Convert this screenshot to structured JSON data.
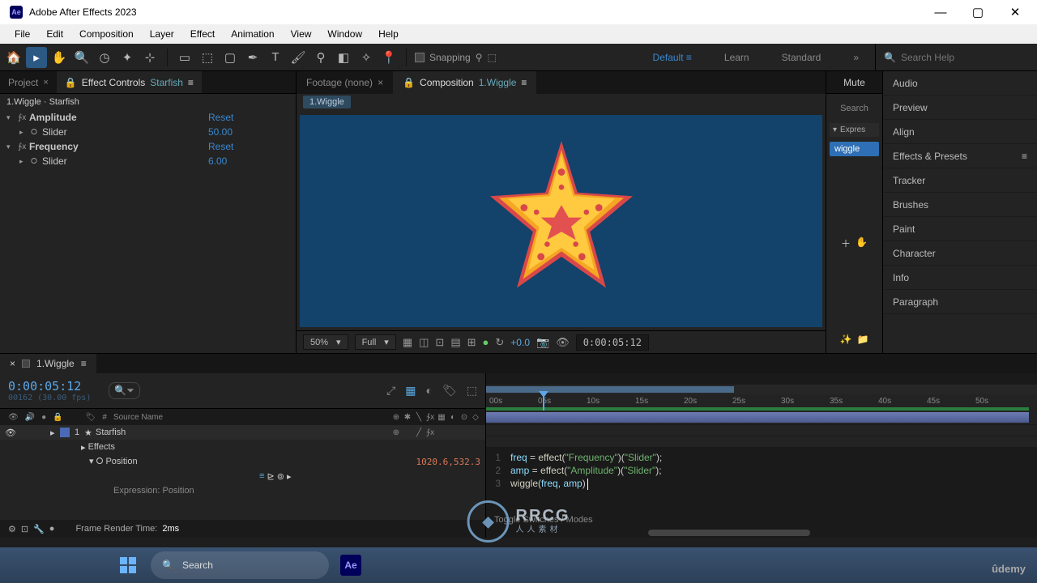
{
  "title": "Adobe After Effects 2023",
  "app_abbr": "Ae",
  "menubar": [
    "File",
    "Edit",
    "Composition",
    "Layer",
    "Effect",
    "Animation",
    "View",
    "Window",
    "Help"
  ],
  "toolbar": {
    "snapping_label": "Snapping",
    "workspace_default": "Default",
    "workspace_learn": "Learn",
    "workspace_standard": "Standard",
    "search_placeholder": "Search Help"
  },
  "left_panel": {
    "tab_project": "Project",
    "tab_effect_controls": "Effect Controls",
    "tab_layer": "Starfish",
    "breadcrumb": "1.Wiggle · Starfish",
    "effects": [
      {
        "name": "Amplitude",
        "reset": "Reset",
        "slider_label": "Slider",
        "slider_value": "50.00"
      },
      {
        "name": "Frequency",
        "reset": "Reset",
        "slider_label": "Slider",
        "slider_value": "6.00"
      }
    ]
  },
  "center_panel": {
    "tab_footage": "Footage  (none)",
    "tab_comp_prefix": "Composition",
    "tab_comp_name": "1.Wiggle",
    "breadcrumb": "1.Wiggle",
    "zoom": "50%",
    "res": "Full",
    "exposure": "+0.0",
    "time": "0:00:05:12"
  },
  "right_narrow": {
    "tab": "Mute",
    "search": "Search",
    "expr": "Expres",
    "chip": "wiggle"
  },
  "right_panel": [
    "Audio",
    "Preview",
    "Align",
    "Effects & Presets",
    "Tracker",
    "Brushes",
    "Paint",
    "Character",
    "Info",
    "Paragraph"
  ],
  "timeline": {
    "tab": "1.Wiggle",
    "time": "0:00:05:12",
    "time_sub": "00162 (30.00 fps)",
    "head_num": "#",
    "head_source": "Source Name",
    "layer_num": "1",
    "layer_name": "Starfish",
    "effects": "Effects",
    "position": "Position",
    "pos_value": "1020.6,532.3",
    "expr_label": "Expression: Position",
    "render_label": "Frame Render Time:",
    "render_val": "2ms",
    "toggle": "Toggle Switches / Modes",
    "ticks": [
      "00s",
      "05s",
      "10s",
      "15s",
      "20s",
      "25s",
      "30s",
      "35s",
      "40s",
      "45s",
      "50s"
    ],
    "code": [
      {
        "n": "1",
        "v": "freq",
        "fn": "effect",
        "s1": "\"Frequency\"",
        "s2": "\"Slider\""
      },
      {
        "n": "2",
        "v": "amp",
        "fn": "effect",
        "s1": "\"Amplitude\"",
        "s2": "\"Slider\""
      },
      {
        "n": "3",
        "fn": "wiggle",
        "a1": "freq",
        "a2": "amp"
      }
    ]
  },
  "taskbar": {
    "search": "Search"
  },
  "watermark": {
    "brand": "RRCG",
    "sub": "人人素材"
  },
  "udemy": "ûdemy"
}
